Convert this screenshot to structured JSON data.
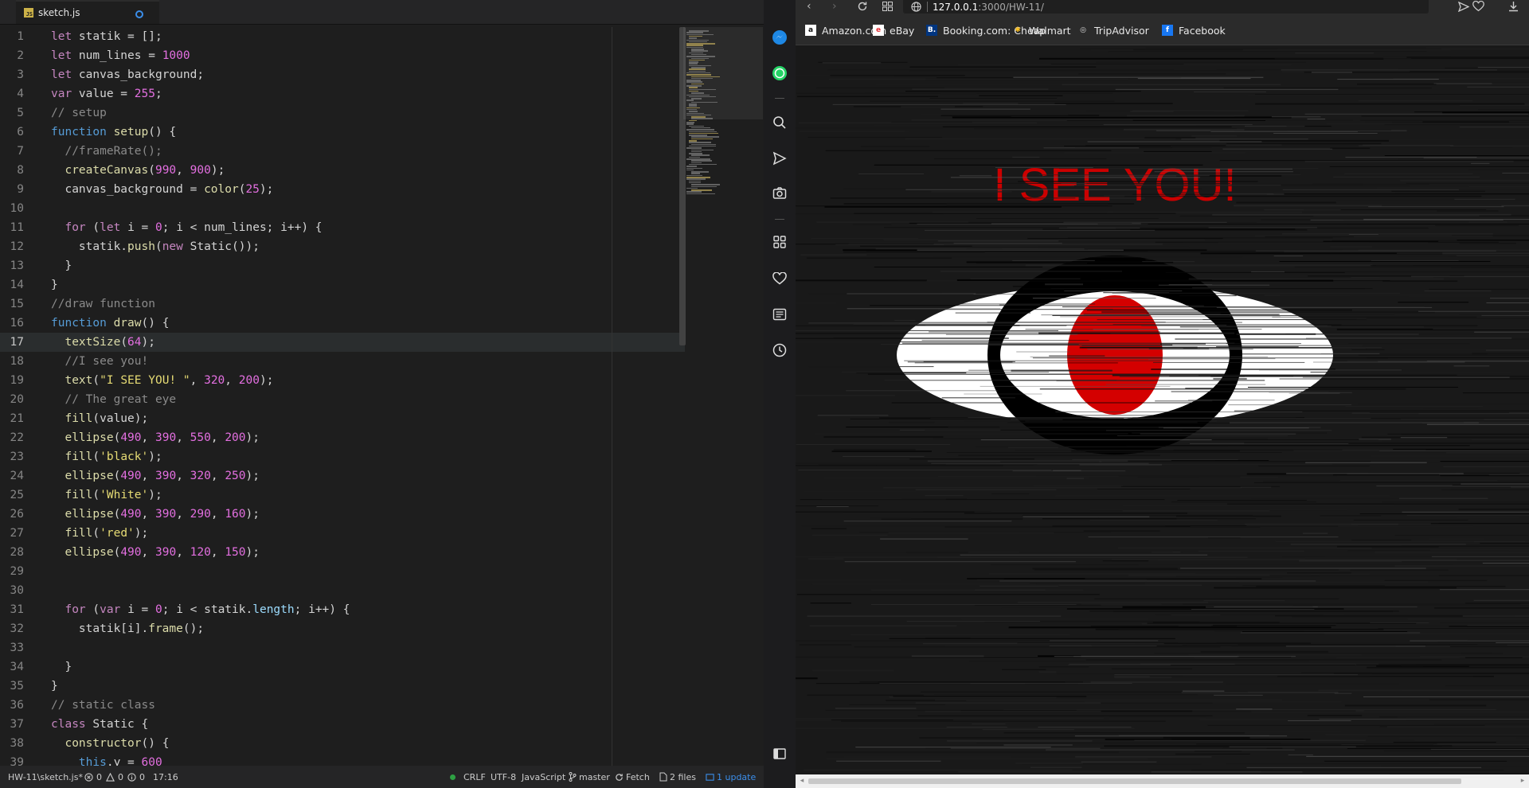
{
  "editor": {
    "tab": {
      "filename": "sketch.js",
      "icon": "javascript-file-icon",
      "modified_icon": "unsaved-dot-icon"
    },
    "active_line": 17,
    "lines": [
      [
        [
          "kw2",
          "let"
        ],
        [
          "id",
          " statik = [];"
        ]
      ],
      [
        [
          "kw2",
          "let"
        ],
        [
          "id",
          " num_lines = "
        ],
        [
          "num",
          "1000"
        ]
      ],
      [
        [
          "kw2",
          "let"
        ],
        [
          "id",
          " canvas_background;"
        ]
      ],
      [
        [
          "kw2",
          "var"
        ],
        [
          "id",
          " value = "
        ],
        [
          "num",
          "255"
        ],
        [
          "id",
          ";"
        ]
      ],
      [
        [
          "com",
          "// setup"
        ]
      ],
      [
        [
          "kw",
          "function"
        ],
        [
          "id",
          " "
        ],
        [
          "fn",
          "setup"
        ],
        [
          "id",
          "() {"
        ]
      ],
      [
        [
          "com",
          "  //frameRate();"
        ]
      ],
      [
        [
          "id",
          "  "
        ],
        [
          "fn",
          "createCanvas"
        ],
        [
          "id",
          "("
        ],
        [
          "num",
          "990"
        ],
        [
          "id",
          ", "
        ],
        [
          "num",
          "900"
        ],
        [
          "id",
          ");"
        ]
      ],
      [
        [
          "id",
          "  canvas_background = "
        ],
        [
          "fn",
          "color"
        ],
        [
          "id",
          "("
        ],
        [
          "num",
          "25"
        ],
        [
          "id",
          ");"
        ]
      ],
      [
        [
          "id",
          ""
        ]
      ],
      [
        [
          "id",
          "  "
        ],
        [
          "kw2",
          "for"
        ],
        [
          "id",
          " ("
        ],
        [
          "kw2",
          "let"
        ],
        [
          "id",
          " i = "
        ],
        [
          "num",
          "0"
        ],
        [
          "id",
          "; i < num_lines; i++) {"
        ]
      ],
      [
        [
          "id",
          "    statik."
        ],
        [
          "fn",
          "push"
        ],
        [
          "id",
          "("
        ],
        [
          "kw2",
          "new"
        ],
        [
          "id",
          " Static());"
        ]
      ],
      [
        [
          "id",
          "  }"
        ]
      ],
      [
        [
          "id",
          "}"
        ]
      ],
      [
        [
          "com",
          "//draw function"
        ]
      ],
      [
        [
          "kw",
          "function"
        ],
        [
          "id",
          " "
        ],
        [
          "fn",
          "draw"
        ],
        [
          "id",
          "() {"
        ]
      ],
      [
        [
          "id",
          "  "
        ],
        [
          "fn",
          "textSize"
        ],
        [
          "id",
          "("
        ],
        [
          "num",
          "64"
        ],
        [
          "id",
          ");"
        ]
      ],
      [
        [
          "com",
          "  //I see you!"
        ]
      ],
      [
        [
          "id",
          "  "
        ],
        [
          "fn",
          "text"
        ],
        [
          "id",
          "("
        ],
        [
          "str",
          "\"I SEE YOU! \""
        ],
        [
          "id",
          ", "
        ],
        [
          "num",
          "320"
        ],
        [
          "id",
          ", "
        ],
        [
          "num",
          "200"
        ],
        [
          "id",
          ");"
        ]
      ],
      [
        [
          "com",
          "  // The great eye"
        ]
      ],
      [
        [
          "id",
          "  "
        ],
        [
          "fn",
          "fill"
        ],
        [
          "id",
          "(value);"
        ]
      ],
      [
        [
          "id",
          "  "
        ],
        [
          "fn",
          "ellipse"
        ],
        [
          "id",
          "("
        ],
        [
          "num",
          "490"
        ],
        [
          "id",
          ", "
        ],
        [
          "num",
          "390"
        ],
        [
          "id",
          ", "
        ],
        [
          "num",
          "550"
        ],
        [
          "id",
          ", "
        ],
        [
          "num",
          "200"
        ],
        [
          "id",
          ");"
        ]
      ],
      [
        [
          "id",
          "  "
        ],
        [
          "fn",
          "fill"
        ],
        [
          "id",
          "("
        ],
        [
          "str",
          "'black'"
        ],
        [
          "id",
          ");"
        ]
      ],
      [
        [
          "id",
          "  "
        ],
        [
          "fn",
          "ellipse"
        ],
        [
          "id",
          "("
        ],
        [
          "num",
          "490"
        ],
        [
          "id",
          ", "
        ],
        [
          "num",
          "390"
        ],
        [
          "id",
          ", "
        ],
        [
          "num",
          "320"
        ],
        [
          "id",
          ", "
        ],
        [
          "num",
          "250"
        ],
        [
          "id",
          ");"
        ]
      ],
      [
        [
          "id",
          "  "
        ],
        [
          "fn",
          "fill"
        ],
        [
          "id",
          "("
        ],
        [
          "str",
          "'White'"
        ],
        [
          "id",
          ");"
        ]
      ],
      [
        [
          "id",
          "  "
        ],
        [
          "fn",
          "ellipse"
        ],
        [
          "id",
          "("
        ],
        [
          "num",
          "490"
        ],
        [
          "id",
          ", "
        ],
        [
          "num",
          "390"
        ],
        [
          "id",
          ", "
        ],
        [
          "num",
          "290"
        ],
        [
          "id",
          ", "
        ],
        [
          "num",
          "160"
        ],
        [
          "id",
          ");"
        ]
      ],
      [
        [
          "id",
          "  "
        ],
        [
          "fn",
          "fill"
        ],
        [
          "id",
          "("
        ],
        [
          "str",
          "'red'"
        ],
        [
          "id",
          ");"
        ]
      ],
      [
        [
          "id",
          "  "
        ],
        [
          "fn",
          "ellipse"
        ],
        [
          "id",
          "("
        ],
        [
          "num",
          "490"
        ],
        [
          "id",
          ", "
        ],
        [
          "num",
          "390"
        ],
        [
          "id",
          ", "
        ],
        [
          "num",
          "120"
        ],
        [
          "id",
          ", "
        ],
        [
          "num",
          "150"
        ],
        [
          "id",
          ");"
        ]
      ],
      [
        [
          "id",
          ""
        ]
      ],
      [
        [
          "id",
          ""
        ]
      ],
      [
        [
          "id",
          "  "
        ],
        [
          "kw2",
          "for"
        ],
        [
          "id",
          " ("
        ],
        [
          "kw2",
          "var"
        ],
        [
          "id",
          " i = "
        ],
        [
          "num",
          "0"
        ],
        [
          "id",
          "; i < statik."
        ],
        [
          "prop",
          "length"
        ],
        [
          "id",
          "; i++) {"
        ]
      ],
      [
        [
          "id",
          "    statik[i]."
        ],
        [
          "fn",
          "frame"
        ],
        [
          "id",
          "();"
        ]
      ],
      [
        [
          "id",
          ""
        ]
      ],
      [
        [
          "id",
          "  }"
        ]
      ],
      [
        [
          "id",
          "}"
        ]
      ],
      [
        [
          "com",
          "// static class"
        ]
      ],
      [
        [
          "kw2",
          "class"
        ],
        [
          "id",
          " Static {"
        ]
      ],
      [
        [
          "id",
          "  "
        ],
        [
          "fn",
          "constructor"
        ],
        [
          "id",
          "() {"
        ]
      ],
      [
        [
          "id",
          "    "
        ],
        [
          "kw",
          "this"
        ],
        [
          "id",
          ".y = "
        ],
        [
          "num",
          "600"
        ]
      ]
    ]
  },
  "statusbar": {
    "path": "HW-11\\sketch.js*",
    "errors": "0",
    "warnings": "0",
    "infos": "0",
    "cursor": "17:16",
    "line_ending": "CRLF",
    "encoding": "UTF-8",
    "language": "JavaScript",
    "branch": "master",
    "fetch": "Fetch",
    "files": "2 files",
    "update": "1 update"
  },
  "sidebar": {
    "icons": [
      "messenger-icon",
      "whatsapp-icon",
      "search-icon",
      "send-icon",
      "camera-icon",
      "apps-grid-icon",
      "heart-icon",
      "news-icon",
      "history-icon",
      "sidebar-toggle-icon"
    ]
  },
  "browser": {
    "url_host": "127.0.0.1",
    "url_path": ":3000/HW-11/",
    "bookmarks": [
      {
        "label": "Amazon.com",
        "icon": "amazon-icon"
      },
      {
        "label": "eBay",
        "icon": "ebay-icon"
      },
      {
        "label": "Booking.com: Cheap",
        "icon": "booking-icon"
      },
      {
        "label": "Walmart",
        "icon": "walmart-icon"
      },
      {
        "label": "TripAdvisor",
        "icon": "tripadvisor-icon"
      },
      {
        "label": "Facebook",
        "icon": "facebook-icon"
      }
    ],
    "sketch": {
      "text": "I SEE YOU!",
      "text_color": "#cc0000",
      "background": "#191919",
      "iris_color": "#d40000"
    }
  }
}
